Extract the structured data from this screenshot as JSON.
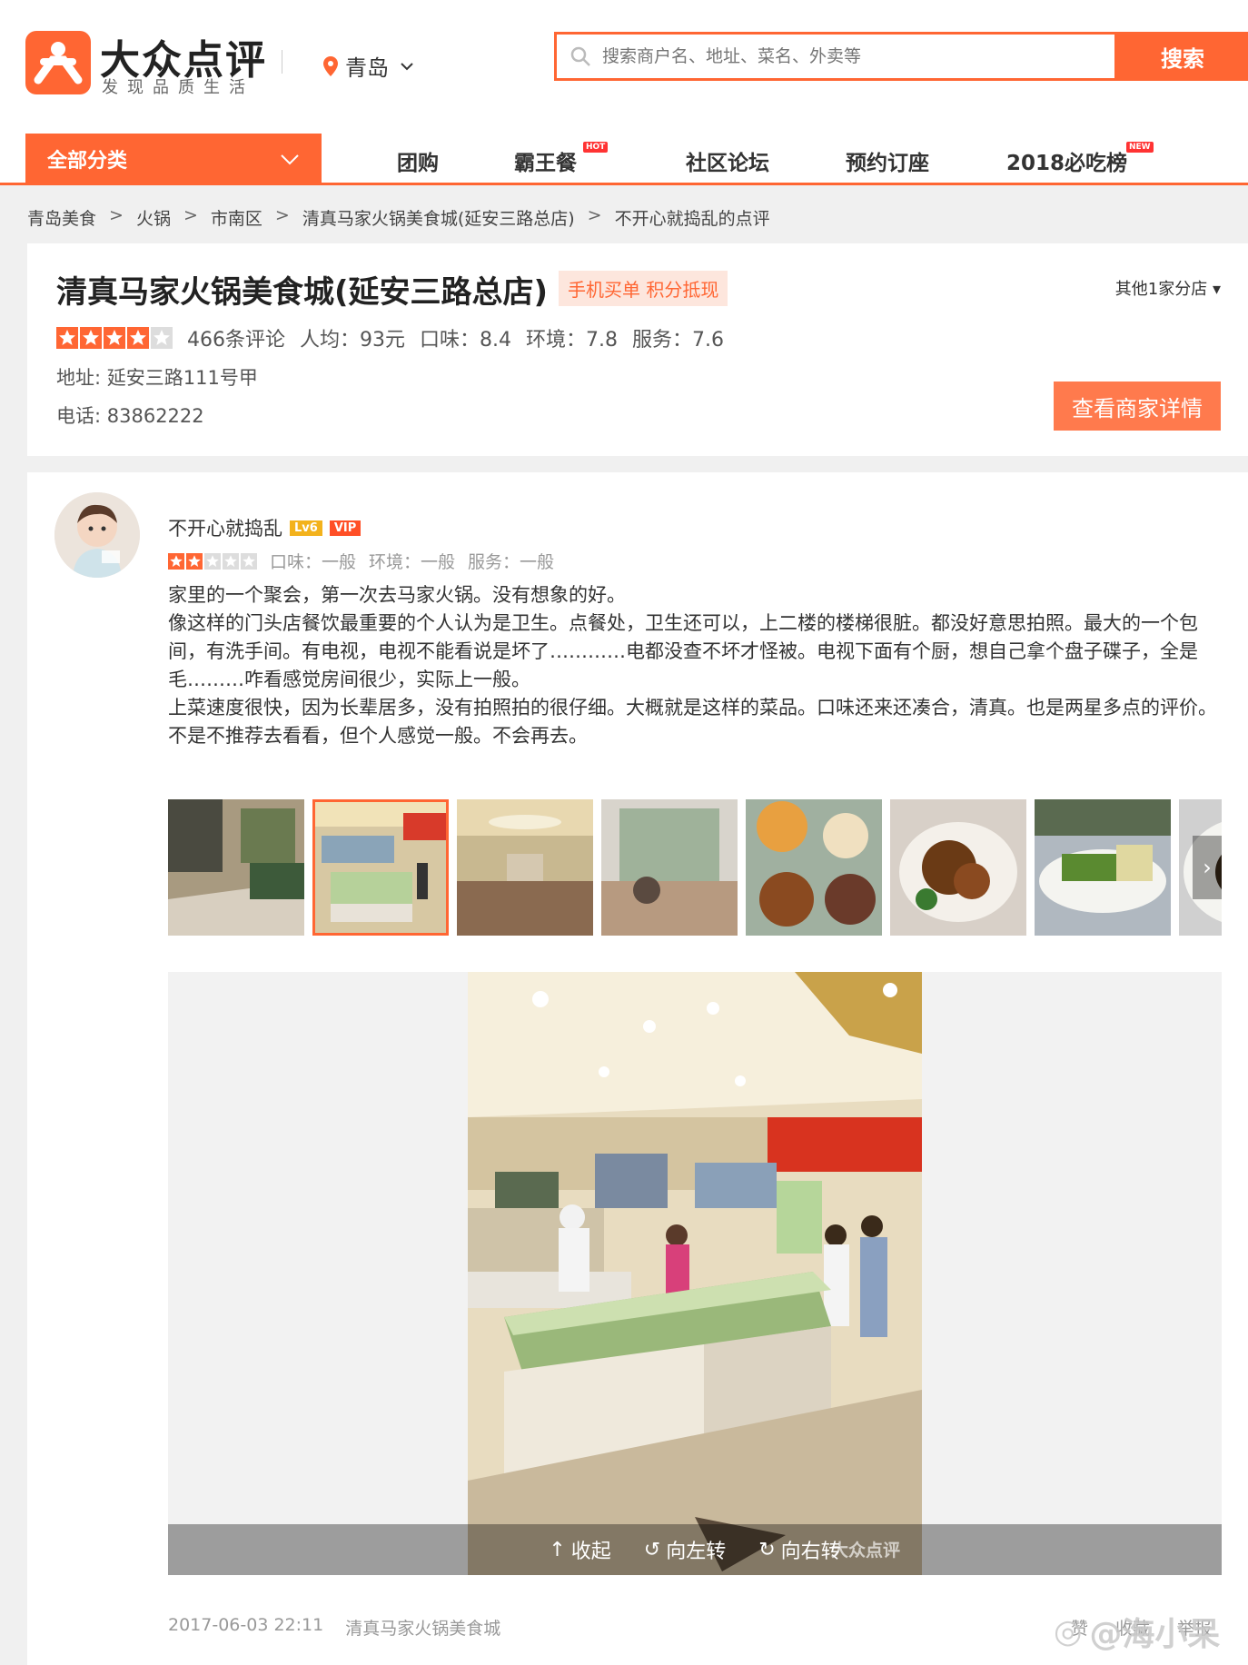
{
  "brand": {
    "name": "大众点评",
    "slogan": "发现品质生活",
    "color": "#ff6633"
  },
  "header": {
    "city": "青岛",
    "search_placeholder": "搜索商户名、地址、菜名、外卖等",
    "search_button": "搜索"
  },
  "nav": {
    "all_categories": "全部分类",
    "items": [
      {
        "label": "团购"
      },
      {
        "label": "霸王餐",
        "tag": "HOT"
      },
      {
        "label": "社区论坛"
      },
      {
        "label": "预约订座"
      },
      {
        "label": "2018必吃榜",
        "tag": "NEW"
      }
    ]
  },
  "breadcrumb": [
    "青岛美食",
    "火锅",
    "市南区",
    "清真马家火锅美食城(延安三路总店)",
    "不开心就捣乱的点评"
  ],
  "shop": {
    "name": "清真马家火锅美食城(延安三路总店)",
    "promo": "手机买单 积分抵现",
    "branches": "其他1家分店",
    "rating_stars": 4,
    "reviews": "466条评论",
    "avg_price": "人均：93元",
    "taste": "口味：8.4",
    "environment": "环境：7.8",
    "service": "服务：7.6",
    "address": "地址: 延安三路111号甲",
    "phone": "电话: 83862222",
    "detail_button": "查看商家详情"
  },
  "review": {
    "user": "不开心就捣乱",
    "level": "Lv6",
    "vip": "VIP",
    "rating_stars": 2,
    "taste": "口味：一般",
    "environment": "环境：一般",
    "service": "服务：一般",
    "paragraphs": [
      "家里的一个聚会，第一次去马家火锅。没有想象的好。",
      "像这样的门头店餐饮最重要的个人认为是卫生。点餐处，卫生还可以，上二楼的楼梯很脏。都没好意思拍照。最大的一个包间，有洗手间。有电视，电视不能看说是坏了…………电都没查不坏才怪被。电视下面有个厨，想自己拿个盘子碟子，全是毛………咋看感觉房间很少，实际上一般。",
      "上菜速度很快，因为长辈居多，没有拍照拍的很仔细。大概就是这样的菜品。口味还来还凑合，清真。也是两星多点的评价。",
      "不是不推荐去看看，但个人感觉一般。不会再去。"
    ],
    "viewer_controls": {
      "collapse": "收起",
      "rotate_left": "向左转",
      "rotate_right": "向右转"
    },
    "viewer_watermark": "大众点评",
    "date": "2017-06-03 22:11",
    "shop_short": "清真马家火锅美食城",
    "action_like": "赞",
    "action_fav": "收藏",
    "action_report": "举报"
  },
  "overlay_watermark": "@海小呆"
}
